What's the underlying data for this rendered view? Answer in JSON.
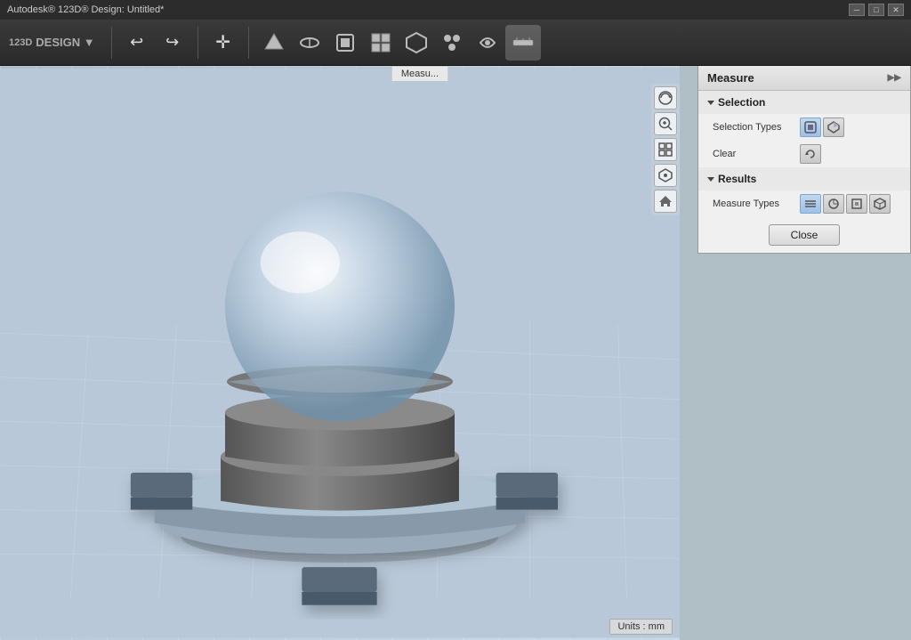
{
  "app": {
    "title": "Autodesk® 123D® Design: Untitled*",
    "logo_text": "123D",
    "logo_sub": "DESIGN ▼"
  },
  "titlebar": {
    "title": "Autodesk® 123D® Design: Untitled*",
    "minimize_label": "─",
    "maximize_label": "□",
    "close_label": "✕"
  },
  "toolbar": {
    "undo_label": "↩",
    "redo_label": "↪",
    "items": [
      "◎",
      "⌀",
      "⬡",
      "⬢",
      "⊞",
      "⬟",
      "⬠",
      "⥁",
      "▦"
    ]
  },
  "measure_panel": {
    "title": "Measure",
    "expand_icon": "▶▶",
    "selection_section": "Selection",
    "selection_types_label": "Selection Types",
    "clear_label": "Clear",
    "results_section": "Results",
    "measure_types_label": "Measure Types",
    "close_label": "Close"
  },
  "viewport": {
    "measure_tab": "Measu..."
  },
  "units": {
    "label": "Units : mm"
  },
  "icons": {
    "selection_type_1": "⬡",
    "selection_type_2": "⬢",
    "clear_icon": "↺",
    "measure_type_1": "≡",
    "measure_type_2": "◈",
    "measure_type_3": "▣",
    "measure_type_4": "◧"
  }
}
